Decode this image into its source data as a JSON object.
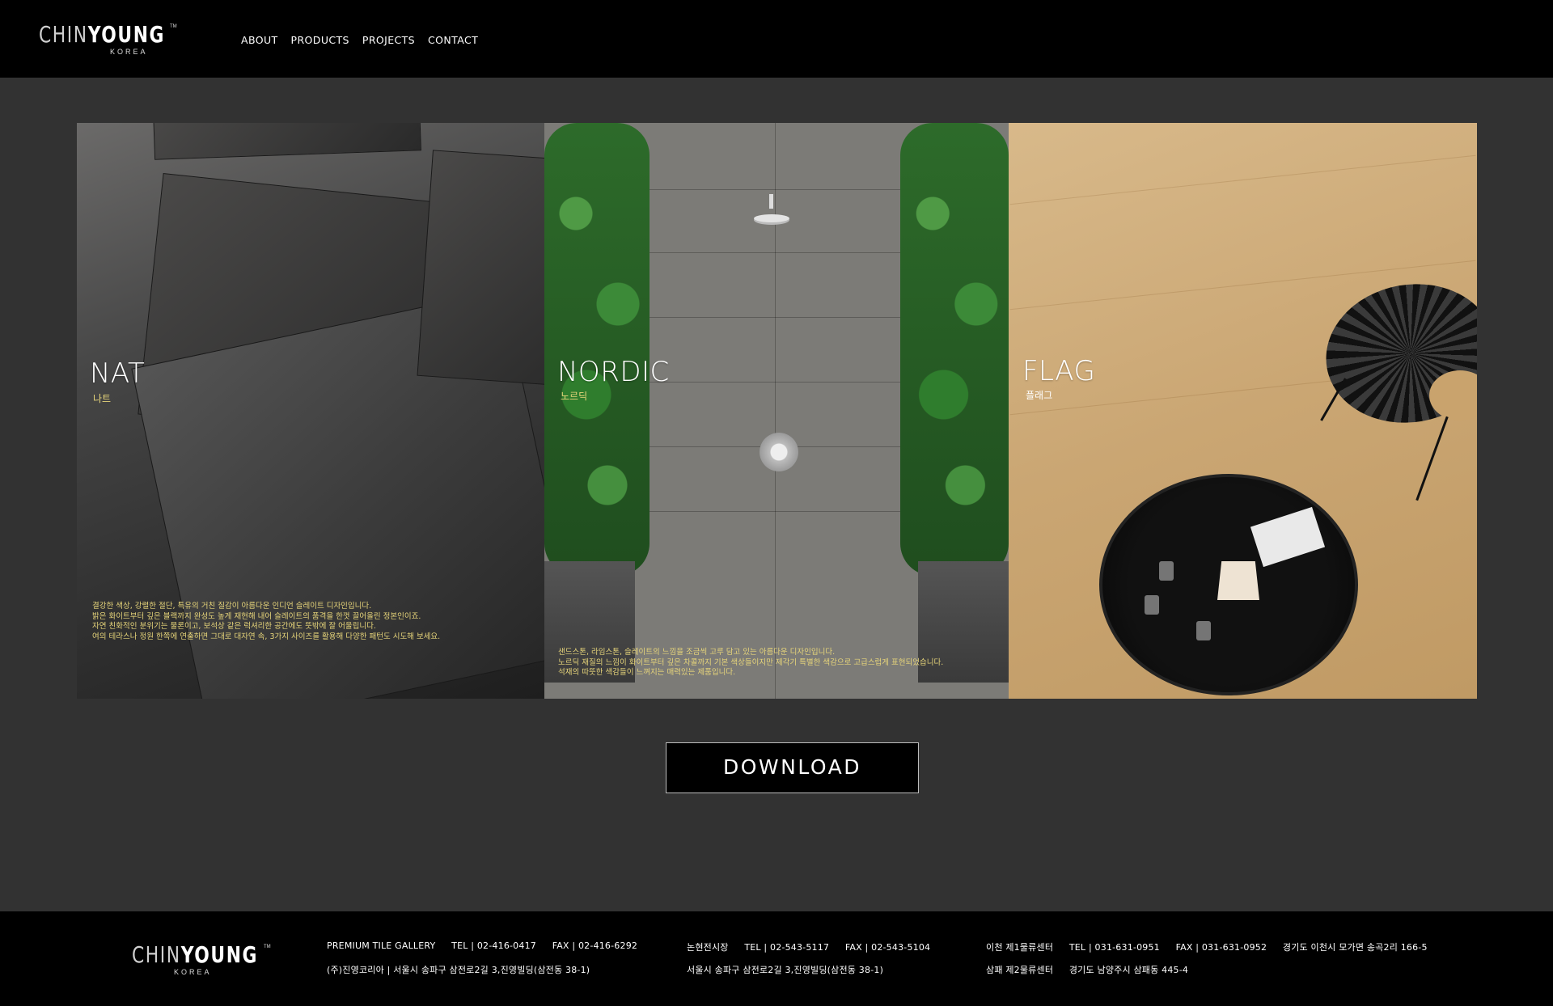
{
  "header": {
    "logo": {
      "brand_light": "CHIN",
      "brand_bold": "YOUNG",
      "sub": "KOREA",
      "tm": "TM"
    },
    "nav": [
      "ABOUT",
      "PRODUCTS",
      "PROJECTS",
      "CONTACT"
    ]
  },
  "gallery": [
    {
      "title": "NAT",
      "subtitle": "나트",
      "subtitle_color": "#e7d57a",
      "description": "결강한 색상, 강렬한 절단, 특유의 거친 질감이 아름다운 인디언 슬레이트 디자인입니다.\n밝은 화이트부터 깊은 블랙까지 완성도 높게 재현해 내어 슬레이트의 품격을 한껏 끌어올린 정본인이죠.\n자연 친화적인 분위기는 물론이고, 보석상 같은 럭셔리한 공간에도 뜻밖에 잘 어울립니다.\n여의 테라스나 정원 한쪽에 연출하면 그대로 대자연 속, 3가지 사이즈를 활용해 다양한 패턴도 시도해 보세요."
    },
    {
      "title": "NORDIC",
      "subtitle": "노르딕",
      "subtitle_color": "#e7d57a",
      "description": "샌드스톤, 라임스톤, 슬레이트의 느낌을 조금씩 고루 담고 있는 아름다운 디자인입니다.\n노르딕 재질의 느낌이 화이트부터 깊은 차콜까지 기본 색상들이지만 제각기 특별한 색감으로 고급스럽게 표현되었습니다.\n석재의 따뜻한 색감들이 느껴지는 매력있는 제품입니다."
    },
    {
      "title": "FLAG",
      "subtitle": "플래그",
      "subtitle_color": "#ffffff",
      "description": ""
    }
  ],
  "download": {
    "label": "DOWNLOAD"
  },
  "footer": {
    "logo": {
      "brand_light": "CHIN",
      "brand_bold": "YOUNG",
      "sub": "KOREA",
      "tm": "TM"
    },
    "row1": [
      [
        "PREMIUM TILE GALLERY",
        "TEL | 02-416-0417",
        "FAX | 02-416-6292"
      ],
      [
        "논현전시장",
        "TEL | 02-543-5117",
        "FAX | 02-543-5104"
      ],
      [
        "이천 제1물류센터",
        "TEL | 031-631-0951",
        "FAX | 031-631-0952",
        "경기도 이천시 모가면 송곡2리 166-5"
      ]
    ],
    "row2": [
      [
        "(주)진영코리아 | 서울시 송파구 삼전로2길 3,진영빌딩(삼전동 38-1)"
      ],
      [
        "서울시 송파구 삼전로2길 3,진영빌딩(삼전동 38-1)"
      ],
      [
        "삼패 제2물류센터",
        "경기도 남양주시 삼패동 445-4"
      ]
    ]
  }
}
